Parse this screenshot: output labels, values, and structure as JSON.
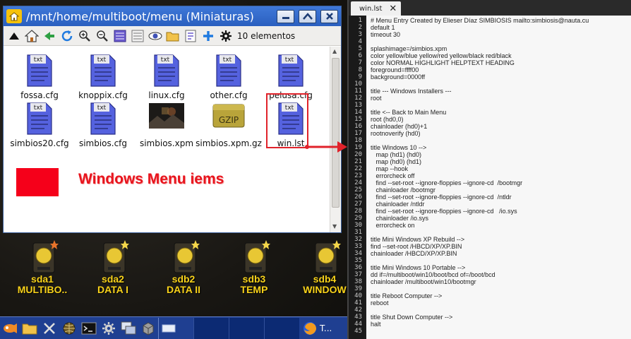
{
  "file_manager": {
    "title": "/mnt/home/multiboot/menu (Miniaturas)",
    "item_count": "10 elementos",
    "files": [
      {
        "name": "fossa.cfg",
        "type": "txt"
      },
      {
        "name": "knoppix.cfg",
        "type": "txt"
      },
      {
        "name": "linux.cfg",
        "type": "txt"
      },
      {
        "name": "other.cfg",
        "type": "txt"
      },
      {
        "name": "pelusa.cfg",
        "type": "txt"
      },
      {
        "name": "simbios20.cfg",
        "type": "txt"
      },
      {
        "name": "simbios.cfg",
        "type": "txt"
      },
      {
        "name": "simbios.xpm",
        "type": "image"
      },
      {
        "name": "simbios.xpm.gz",
        "type": "gzip"
      },
      {
        "name": "win.lst",
        "type": "txt"
      }
    ],
    "txt_badge": "txt",
    "gzip_badge": "GZIP"
  },
  "annotation": {
    "text": "Windows Menu iems",
    "color": "#e8141d"
  },
  "drives": [
    {
      "name": "sda1",
      "label": "MULTIBO..",
      "star": "#e8732a"
    },
    {
      "name": "sda2",
      "label": "DATA I",
      "star": "#f4d64a"
    },
    {
      "name": "sdb2",
      "label": "DATA II",
      "star": "#f4d64a"
    },
    {
      "name": "sdb3",
      "label": "TEMP",
      "star": "#f4d64a"
    },
    {
      "name": "sdb4",
      "label": "WINDOW",
      "star": "#f4d64a"
    }
  ],
  "taskbar": {
    "firefox_label": "T..."
  },
  "editor": {
    "tab_title": "win.lst",
    "lines": [
      "# Menu Entry Created by Elieser Díaz SIMBIOSIS mailto:simbiosis@nauta.cu",
      "default 1",
      "timeout 30",
      "",
      "splashimage=/simbios.xpm",
      "color yellow/blue yellow/red yellow/black red/black",
      "color NORMAL HIGHLIGHT HELPTEXT HEADING",
      "foreground=ffff00",
      "background=0000ff",
      "",
      "title --- Windows Installers ---",
      "root",
      "",
      "title <-- Back to Main Menu",
      "root (hd0,0)",
      "chainloader (hd0)+1",
      "rootnoverify (hd0)",
      "",
      "title Windows 10 -->",
      "   map (hd1) (hd0)",
      "   map (hd0) (hd1)",
      "   map --hook",
      "   errorcheck off",
      "   find --set-root --ignore-floppies --ignore-cd  /bootmgr",
      "   chainloader /bootmgr",
      "   find --set-root --ignore-floppies --ignore-cd  /ntldr",
      "   chainloader /ntldr",
      "   find --set-root --ignore-floppies --ignore-cd   /io.sys",
      "   chainloader /io.sys",
      "   errorcheck on",
      "",
      "title Mini Windows XP Rebuild -->",
      "find --set-root /HBCD/XP/XP.BIN",
      "chainloader /HBCD/XP/XP.BIN",
      "",
      "title Mini Windows 10 Portable -->",
      "dd if=/multiboot/win10/boot/bcd of=/boot/bcd",
      "chainloader /multiboot/win10/bootmgr",
      "",
      "title Reboot Computer -->",
      "reboot",
      "",
      "title Shut Down Computer -->",
      "halt",
      ""
    ]
  },
  "colors": {
    "titlebar": "#2a5fbf",
    "file_icon": "#4c5bd8",
    "drive_label": "#f8d21a",
    "highlight": "#e0222a"
  }
}
